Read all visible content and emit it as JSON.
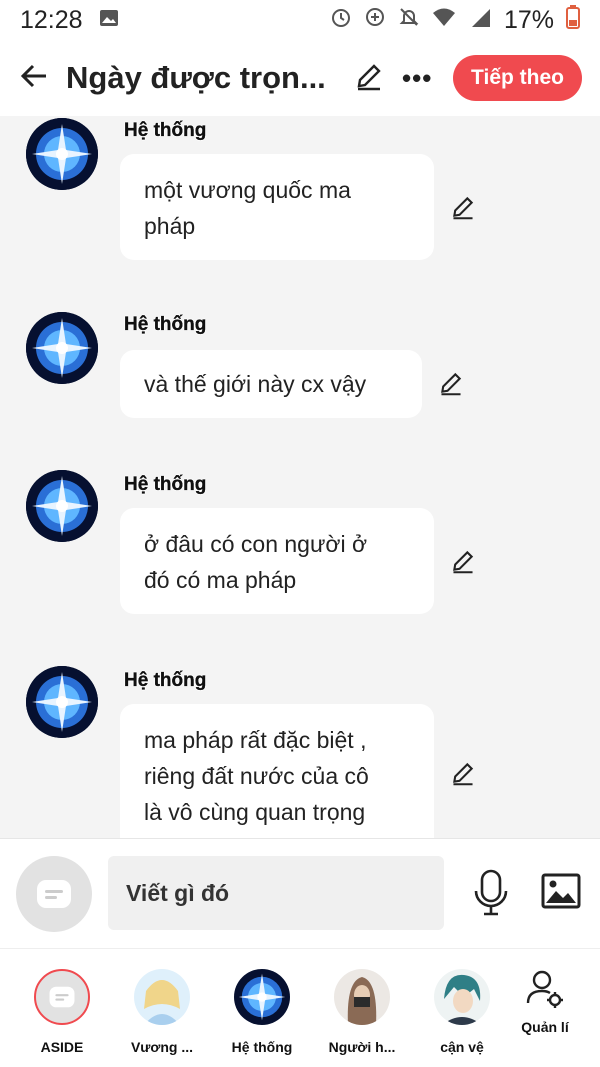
{
  "status_bar": {
    "time": "12:28",
    "battery": "17%"
  },
  "header": {
    "title": "Ngày được trọn...",
    "next_label": "Tiếp theo"
  },
  "messages": [
    {
      "sender": "Hệ thống",
      "lines": [
        "một vương quốc ma",
        "pháp"
      ]
    },
    {
      "sender": "Hệ thống",
      "lines": [
        "và thế giới này cx vậy"
      ]
    },
    {
      "sender": "Hệ thống",
      "lines": [
        "ở đâu có con người ở",
        "đó có ma pháp"
      ]
    },
    {
      "sender": "Hệ thống",
      "lines": [
        "ma pháp rất đặc biệt ,",
        "riêng đất nước của cô",
        "là vô cùng quan trọng"
      ]
    }
  ],
  "composer": {
    "placeholder": "Viết gì đó"
  },
  "characters": [
    {
      "label": "ASIDE"
    },
    {
      "label": "Vương ..."
    },
    {
      "label": "Hệ thống"
    },
    {
      "label": "Người h..."
    },
    {
      "label": "cận vệ"
    },
    {
      "label": "Quản lí"
    }
  ],
  "colors": {
    "accent": "#f04a4f",
    "background": "#f4f4f4",
    "bubble": "#ffffff"
  }
}
